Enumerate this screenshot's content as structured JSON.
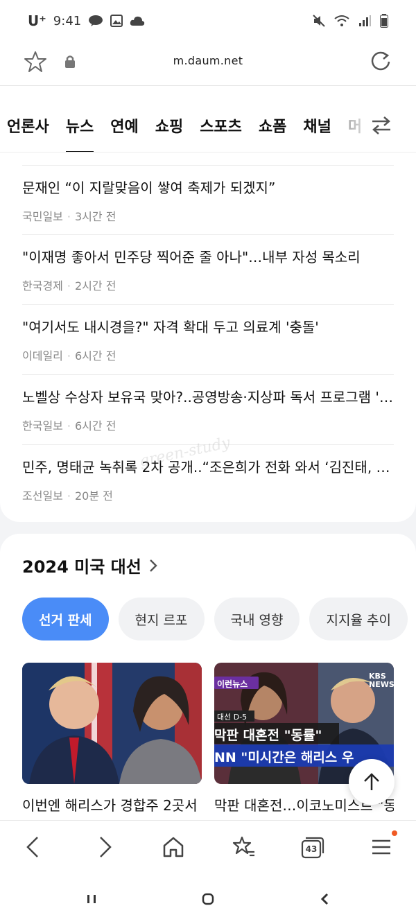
{
  "status_bar": {
    "carrier": "U⁺",
    "time": "9:41"
  },
  "browser": {
    "url": "m.daum.net"
  },
  "categories": {
    "tabs": [
      "언론사",
      "뉴스",
      "연예",
      "쇼핑",
      "스포츠",
      "쇼폼",
      "채널",
      "머"
    ],
    "active_index": 1
  },
  "news": [
    {
      "title": "문재인 “이 지랄맞음이 쌓여 축제가 되겠지”",
      "source": "국민일보",
      "time": "3시간 전"
    },
    {
      "title": "\"이재명 좋아서 민주당 찍어준 줄 아나\"…내부 자성 목소리",
      "source": "한국경제",
      "time": "2시간 전"
    },
    {
      "title": "\"여기서도 내시경을?\" 자격 확대 두고 의료계 '충돌'",
      "source": "이데일리",
      "time": "6시간 전"
    },
    {
      "title": "노벨상 수상자 보유국 맞아?..공영방송·지상파 독서 프로그램 '0…",
      "source": "한국일보",
      "time": "6시간 전"
    },
    {
      "title": "민주, 명태균 녹취록 2차 공개..“조은희가 전화 와서 ‘김진태, …",
      "source": "조선일보",
      "time": "20분 전"
    }
  ],
  "election": {
    "title": "2024 미국 대선",
    "chips": [
      "선거 판세",
      "현지 르포",
      "국내 영향",
      "지지율 추이"
    ],
    "active_chip": 0,
    "thumbs": [
      {
        "caption": "이번엔 해리스가 경합주 2곳서"
      },
      {
        "caption": "막판 대혼전…이코노미스트 \"동",
        "tag": "이런뉴스",
        "subtag": "대선 D-5",
        "overlay1": "막판 대혼전 \"동률\"",
        "overlay2": "NN \"미시간은 해리스 우",
        "brand": "KBS NEWS"
      }
    ]
  },
  "toolbar": {
    "tabs_count": "43"
  },
  "watermark": "green-study"
}
